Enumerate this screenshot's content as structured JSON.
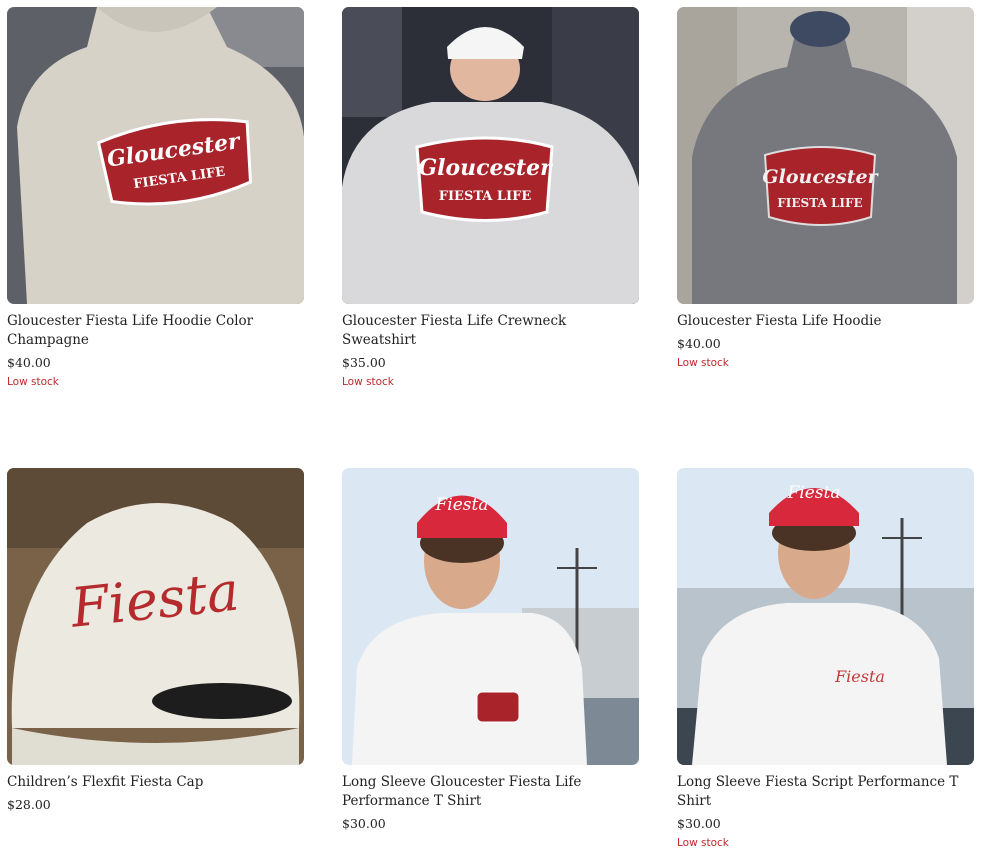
{
  "products": [
    {
      "title": "Gloucester Fiesta Life Hoodie Color Champagne",
      "price": "$40.00",
      "stock": "Low stock",
      "logo_line1": "Gloucester",
      "logo_line2": "FIESTA LIFE"
    },
    {
      "title": "Gloucester Fiesta Life Crewneck Sweatshirt",
      "price": "$35.00",
      "stock": "Low stock",
      "logo_line1": "Gloucester",
      "logo_line2": "FIESTA LIFE"
    },
    {
      "title": "Gloucester Fiesta Life Hoodie",
      "price": "$40.00",
      "stock": "Low stock",
      "logo_line1": "Gloucester",
      "logo_line2": "FIESTA LIFE"
    },
    {
      "title": "Children’s Flexfit Fiesta Cap",
      "price": "$28.00",
      "stock": "",
      "logo_line1": "Fiesta"
    },
    {
      "title": "Long Sleeve Gloucester Fiesta Life Performance T Shirt",
      "price": "$30.00",
      "stock": "",
      "logo_line1": "Fiesta"
    },
    {
      "title": "Long Sleeve Fiesta Script Performance T Shirt",
      "price": "$30.00",
      "stock": "Low stock",
      "logo_line1": "Fiesta"
    }
  ],
  "colors": {
    "accent_red": "#c0282d",
    "logo_red": "#a8232a"
  }
}
